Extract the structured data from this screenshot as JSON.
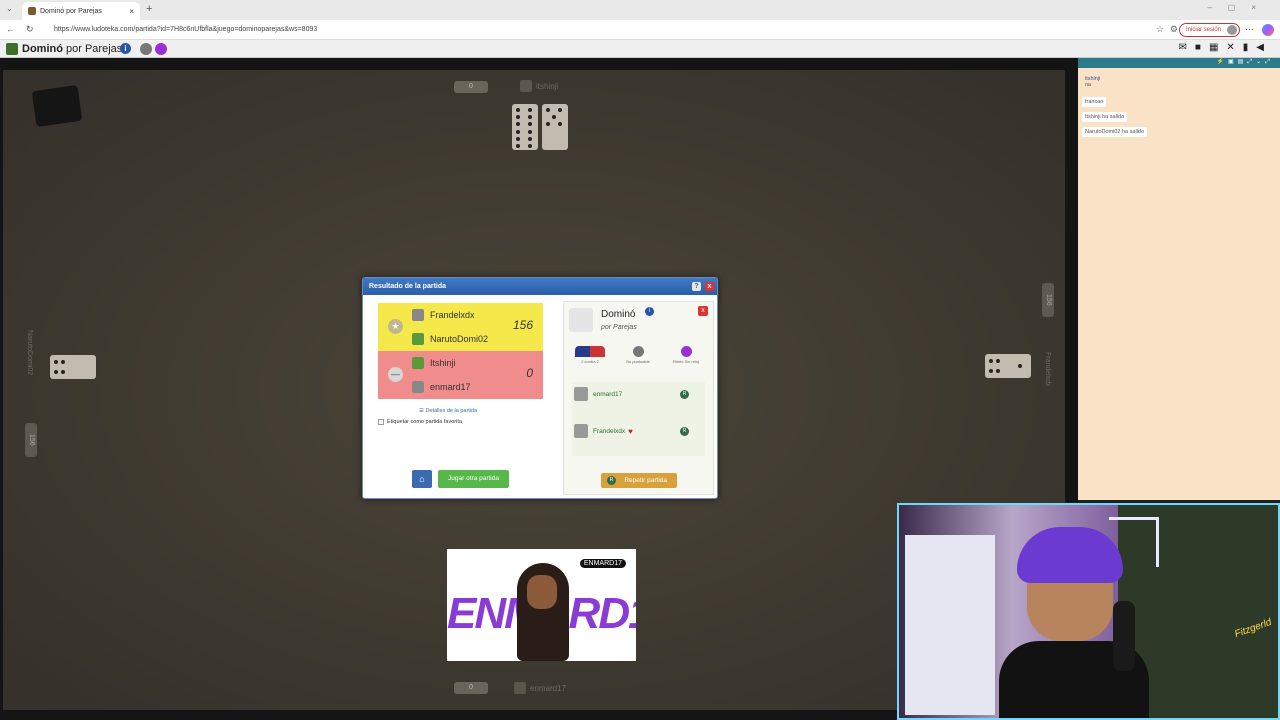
{
  "browser": {
    "tab_title": "Dominó por Parejas",
    "url": "https://www.ludoteka.com/partida?id=7H8c6nUfbfla&juego=dominoparejas&ws=8093",
    "signin": "Iniciar sesión"
  },
  "app": {
    "title_bold": "Dominó",
    "title_rest": " por Parejas",
    "info": "i"
  },
  "board": {
    "top_score": "0",
    "top_player": "itshinji",
    "left_score": "156",
    "left_player": "NarutoDomi02",
    "right_score": "156",
    "right_player": "Frandelxdx",
    "bottom_score": "0",
    "bottom_player": "enmard17"
  },
  "dialog": {
    "title": "Resultado de la partida",
    "help": "?",
    "close": "x",
    "winners": {
      "players": [
        "Frandelxdx",
        "NarutoDomi02"
      ],
      "score": "156",
      "icon": "★"
    },
    "losers": {
      "players": [
        "Itshinji",
        "enmard17"
      ],
      "score": "0",
      "icon": "—"
    },
    "details_link": "Detalles de la partida",
    "favorite_label": "Etiquetar como partida favorita",
    "home_icon": "home-icon",
    "play_again": "Jugar otra partida",
    "game_card": {
      "close": "x",
      "title": "Dominó",
      "info": "i",
      "subtitle": "por Parejas",
      "options": [
        "2 contra 2",
        "No puntuable",
        "Ritmo Sin reloj"
      ],
      "players": [
        {
          "name": "enmard17",
          "badge": "R",
          "heart": false
        },
        {
          "name": "Frandelxdx",
          "badge": "R",
          "heart": true
        }
      ],
      "repeat_badge": "R",
      "repeat_label": "Repetir partida"
    }
  },
  "chat": {
    "messages": [
      {
        "who": "itshinji",
        "text": "na"
      },
      {
        "who": "",
        "text": "francao"
      },
      {
        "who": "",
        "text": "Itshinji ha salido"
      },
      {
        "who": "",
        "text": "NarutoDomi02 ha salido"
      }
    ]
  },
  "stream": {
    "banner_text": "ENMARD17",
    "banner_tag": "ENMARD17",
    "cam_logo": "Fitzgerld"
  },
  "colors": {
    "win_row": "#f4e84a",
    "lose_row": "#f08c8c",
    "dialog_header": "#2c5fa6",
    "chat_bg": "#f9e2c5",
    "cam_border": "#6fd8ff"
  }
}
